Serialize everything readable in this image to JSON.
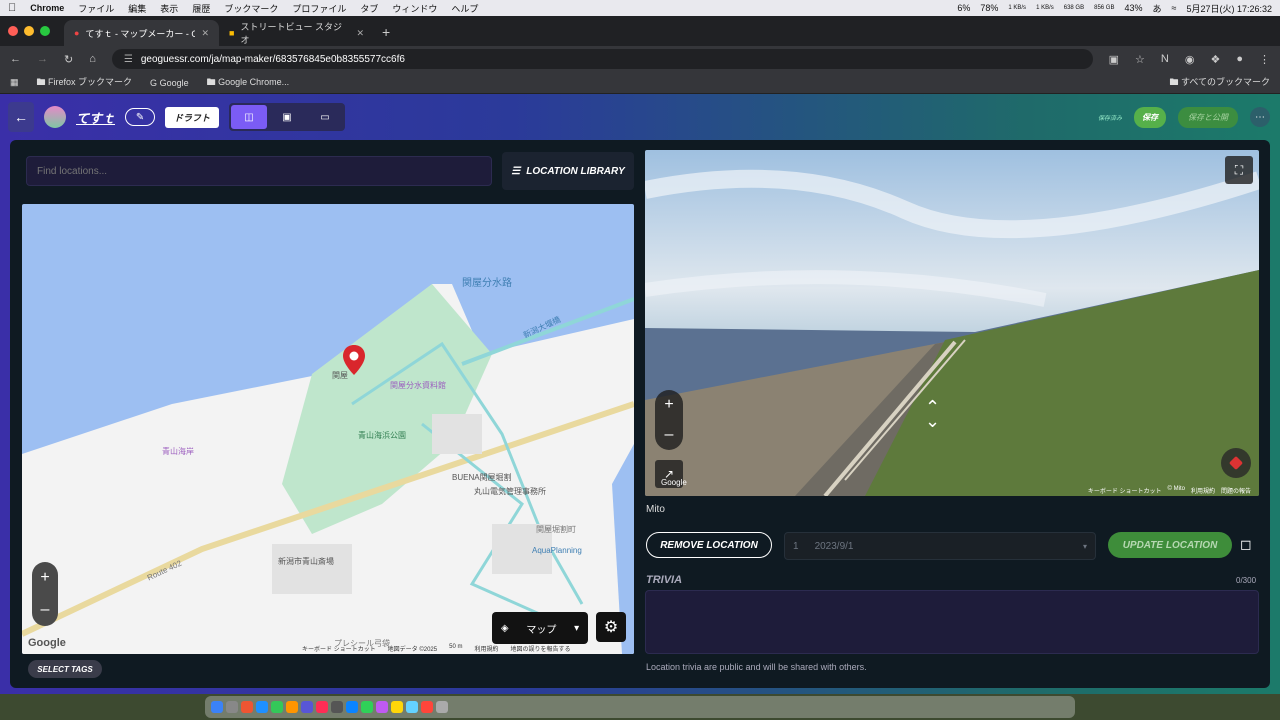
{
  "macbar": {
    "app": "Chrome",
    "menus": [
      "ファイル",
      "編集",
      "表示",
      "履歴",
      "ブックマーク",
      "プロファイル",
      "タブ",
      "ウィンドウ",
      "ヘルプ"
    ],
    "cpu": "6%",
    "battery": "78%",
    "net_up": "1 KB/s",
    "net_down": "1 KB/s",
    "disk": "638 GB",
    "disk2": "856 GB",
    "mem": "43%",
    "ime": "あ",
    "clock": "5月27日(火) 17:26:32"
  },
  "tabs": [
    {
      "title": "てすｔ - マップメーカー - GeoG",
      "active": true
    },
    {
      "title": "ストリートビュー スタジオ",
      "active": false
    }
  ],
  "address": {
    "url": "geoguessr.com/ja/map-maker/683576845e0b8355577cc6f6"
  },
  "bookmarks": {
    "items": [
      "Firefox ブックマーク",
      "Google",
      "Google Chrome..."
    ],
    "all": "すべてのブックマーク"
  },
  "header": {
    "map_name": "てすｔ",
    "draft": "ドラフト",
    "save_status": "保存済み",
    "save": "保存",
    "save_publish": "保存と公開"
  },
  "search": {
    "placeholder": "Find locations..."
  },
  "library": {
    "label": "LOCATION LIBRARY"
  },
  "map": {
    "labels": {
      "l1": "関屋分水路",
      "l2": "新潟大堰橋",
      "l3": "関屋分水資料館",
      "l4": "青山海浜公園",
      "l5": "青山海岸",
      "l6": "BUENA関屋堀割",
      "l7": "丸山電気管理事務所",
      "l8": "関屋堀割町",
      "l9": "AquaPlanning",
      "l10": "新潟市青山斎場",
      "l11": "Route 402",
      "l12": "関屋",
      "l13": "プレシール弓袋"
    },
    "type_toggle": "マップ",
    "footer": [
      "キーボード ショートカット",
      "地図データ ©2025",
      "50 m",
      "利用規約",
      "地図の誤りを報告する"
    ],
    "google": "Google"
  },
  "tags_button": "SELECT TAGS",
  "streetview": {
    "google": "Google",
    "footer": [
      "キーボード ショートカット",
      "© Mito",
      "利用規約",
      "問題の報告"
    ]
  },
  "location": {
    "author": "Mito",
    "remove": "REMOVE LOCATION",
    "date_index": "1",
    "date": "2023/9/1",
    "update": "UPDATE LOCATION"
  },
  "trivia": {
    "label": "TRIVIA",
    "count": "0/300",
    "value": "",
    "note": "Location trivia are public and will be shared with others."
  },
  "colors": {
    "accent": "#7b5cf5",
    "save": "#56b04a",
    "pin": "#d9262c"
  }
}
